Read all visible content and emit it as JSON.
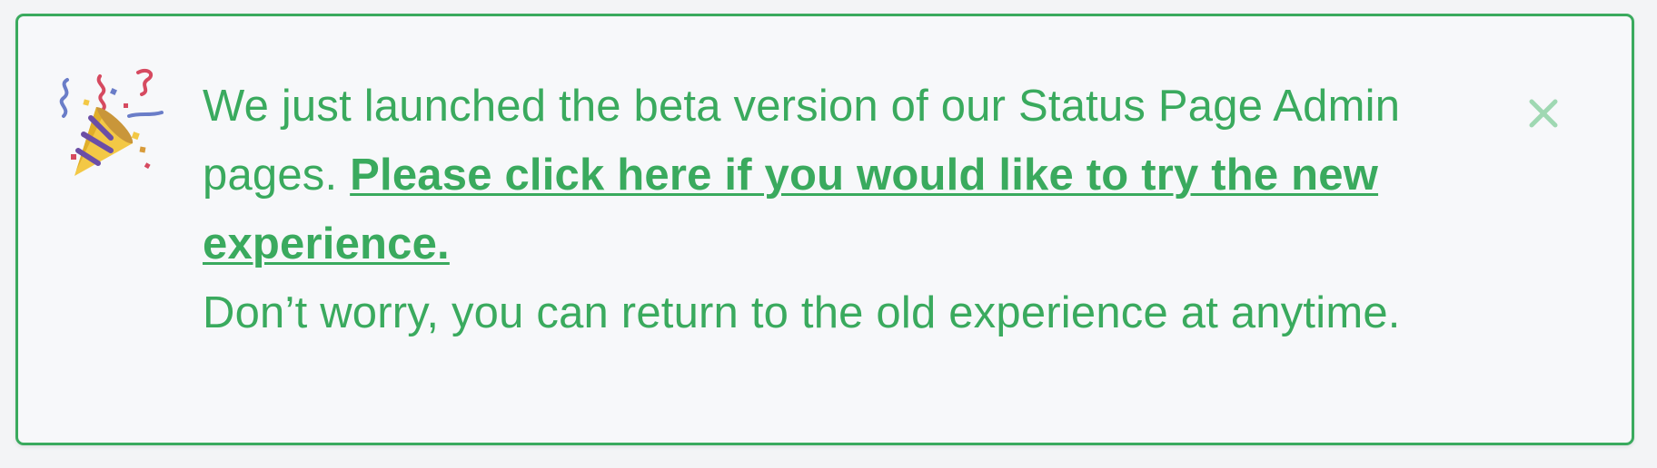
{
  "banner": {
    "intro_text": "We just launched the beta version of our Status Page Admin pages.",
    "link_text": "Please click here if you would like to try the new experience.",
    "followup_text": "Don’t worry, you can return to the old experience at anytime.",
    "icon": "party-popper-icon",
    "close_icon": "close-icon",
    "colors": {
      "accent": "#3aaa5e",
      "close": "#9fd8b2",
      "background": "#f7f8fa"
    }
  }
}
